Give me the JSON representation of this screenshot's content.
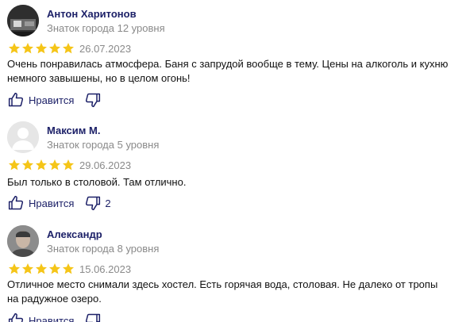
{
  "colors": {
    "star": "#f5c518",
    "author": "#1d2168",
    "muted": "#8a8a8a",
    "action": "#1d2168"
  },
  "reviews": [
    {
      "author": "Антон Харитонов",
      "level": "Знаток города 12 уровня",
      "rating": 5,
      "date": "26.07.2023",
      "text": "Очень понравилась атмосфера. Баня с запрудой вообще в тему. Цены на алкоголь и кухню немного завышены, но в целом огонь!",
      "like_label": "Нравится",
      "dislike_count": "",
      "avatar_icon": "user-photo"
    },
    {
      "author": "Максим М.",
      "level": "Знаток города 5 уровня",
      "rating": 5,
      "date": "29.06.2023",
      "text": "Был только в столовой. Там отлично.",
      "like_label": "Нравится",
      "dislike_count": "2",
      "avatar_icon": "default-user-icon"
    },
    {
      "author": "Александр",
      "level": "Знаток города 8 уровня",
      "rating": 5,
      "date": "15.06.2023",
      "text": "Отличное место снимали здесь хостел. Есть горячая вода, столовая. Не далеко от тропы на радужное озеро.",
      "like_label": "Нравится",
      "dislike_count": "",
      "avatar_icon": "user-photo"
    }
  ]
}
